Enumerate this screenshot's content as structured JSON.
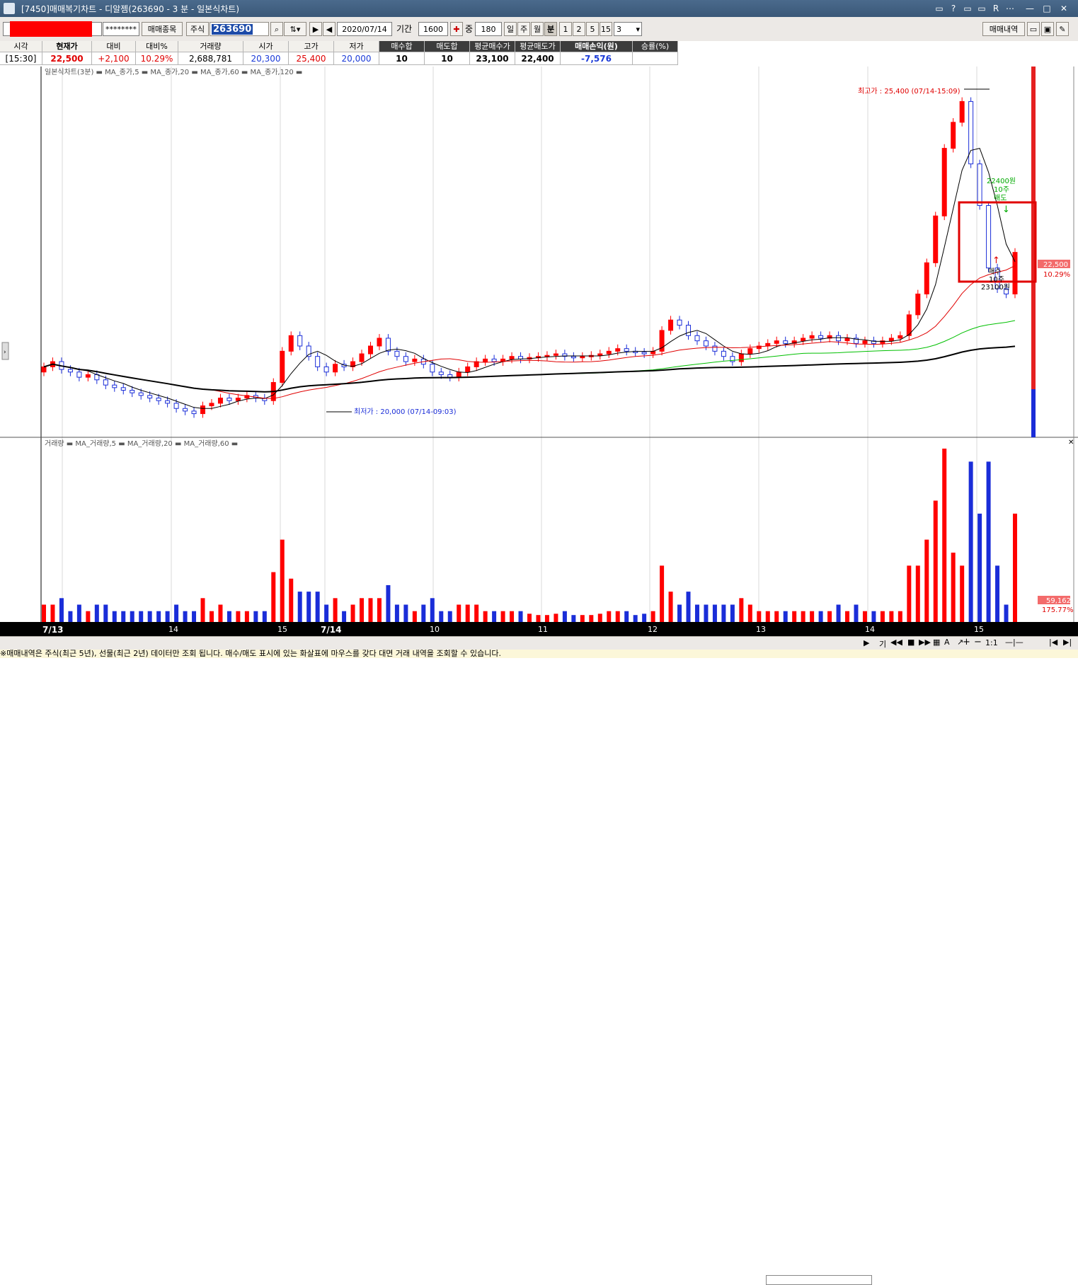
{
  "window": {
    "title": "[7450]매매복기차트 - 디알젬(263690 - 3 분 - 일본식차트)"
  },
  "title_icons": [
    "help-icon",
    "question-icon",
    "pin-icon",
    "restore-icon",
    "font-icon",
    "extra-icon",
    "minimize-icon",
    "maximize-icon",
    "close-icon"
  ],
  "toolbar": {
    "account_mask": "********",
    "trade_item_label": "매매종목",
    "stock_label": "주식",
    "stock_code": "263690",
    "date": "2020/07/14",
    "period_label": "기간",
    "period_value": "1600",
    "jung_label": "중",
    "count_value": "180",
    "day": "일",
    "week": "주",
    "month": "월",
    "minute": "분",
    "n1": "1",
    "n2": "2",
    "n5": "5",
    "n15": "15",
    "interval": "3",
    "history_button": "매매내역"
  },
  "info": {
    "headers": [
      "시각",
      "현재가",
      "대비",
      "대비%",
      "거래량",
      "시가",
      "고가",
      "저가",
      "매수합",
      "매도합",
      "평균매수가",
      "평균매도가",
      "매매손익(원)",
      "승률(%)"
    ],
    "values": [
      "[15:30]",
      "22,500",
      "+2,100",
      "10.29%",
      "2,688,781",
      "20,300",
      "25,400",
      "20,000",
      "10",
      "10",
      "23,100",
      "22,400",
      "-7,576",
      ""
    ]
  },
  "price_panel": {
    "legend": "일본식차트(3분) ▬ MA_종가,5 ▬ MA_종가,20 ▬ MA_종가,60 ▬ MA_종가,120 ▬",
    "high_note": "최고가 : 25,400 (07/14-15:09)",
    "low_note": "최저가 : 20,000 (07/14-09:03)",
    "sell_note": [
      "22400원",
      "10주",
      "매도"
    ],
    "buy_note": [
      "매수",
      "10주",
      "23100원"
    ],
    "last_price": "22,500",
    "last_pct": "10.29%"
  },
  "volume_panel": {
    "legend": "거래량 ▬ MA_거래량,5 ▬ MA_거래량,20 ▬ MA_거래량,60 ▬",
    "last_volume": "59,162",
    "last_pct": "175.77%"
  },
  "x_axis": {
    "labels": [
      "7/13",
      "14",
      "15",
      "7/14",
      "10",
      "11",
      "12",
      "13",
      "14",
      "15"
    ]
  },
  "bottom_bar": {
    "items": [
      "기",
      "1:1"
    ]
  },
  "status": "※매매내역은 주식(최근 5년), 선물(최근 2년) 데이터만 조회 됩니다. 매수/매도 표시에 있는 화살표에 마우스를 갖다 대면 거래 내역을 조회할 수 있습니다.",
  "colors": {
    "up": "#ff0000",
    "down": "#1a2dd8",
    "ma5": "#000000",
    "ma20": "#e00000",
    "ma60": "#00c000",
    "ma120": "#000000"
  },
  "chart_data": {
    "type": "candlestick",
    "interval": "3분",
    "x_labels": [
      "7/13",
      "14",
      "15",
      "7/14",
      "10",
      "11",
      "12",
      "13",
      "14",
      "15"
    ],
    "high": {
      "value": 25400,
      "time": "07/14-15:09"
    },
    "low": {
      "value": 20000,
      "time": "07/14-09:03"
    },
    "last_close": 22500,
    "change_pct": 10.29,
    "approx_series": {
      "7/13": [
        20300,
        20400,
        20250,
        20200,
        20100,
        20150,
        20050,
        19950,
        19900,
        19850,
        19800,
        19750,
        19700,
        19650,
        19600,
        19500,
        19450,
        19400,
        19550,
        19600,
        19700,
        19650,
        19700,
        19750,
        19700,
        19650
      ],
      "7/14_morning": [
        20000,
        20600,
        20900,
        20700,
        20500,
        20300,
        20200,
        20350,
        20300,
        20400,
        20550,
        20700,
        20850,
        20600,
        20500,
        20400,
        20450,
        20350,
        20200,
        20150,
        20100,
        20200,
        20300,
        20400,
        20450,
        20400,
        20450,
        20500,
        20450,
        20480,
        20500,
        20520,
        20550,
        20500,
        20480,
        20500,
        20520
      ],
      "7/14_midday": [
        20550,
        20600,
        20650,
        20600,
        20580,
        20550,
        20600,
        21000,
        21200,
        21100,
        20900,
        20800,
        20700,
        20600,
        20500,
        20400,
        20550,
        20650,
        20700,
        20750,
        20800,
        20750,
        20800,
        20850,
        20900,
        20850,
        20900,
        20800,
        20850,
        20750,
        20800,
        20750,
        20800,
        20850
      ],
      "7/14_close": [
        20900,
        21300,
        21700,
        22300,
        23200,
        24500,
        25000,
        25400,
        24200,
        23400,
        22200,
        21800,
        21700,
        22500
      ]
    }
  }
}
